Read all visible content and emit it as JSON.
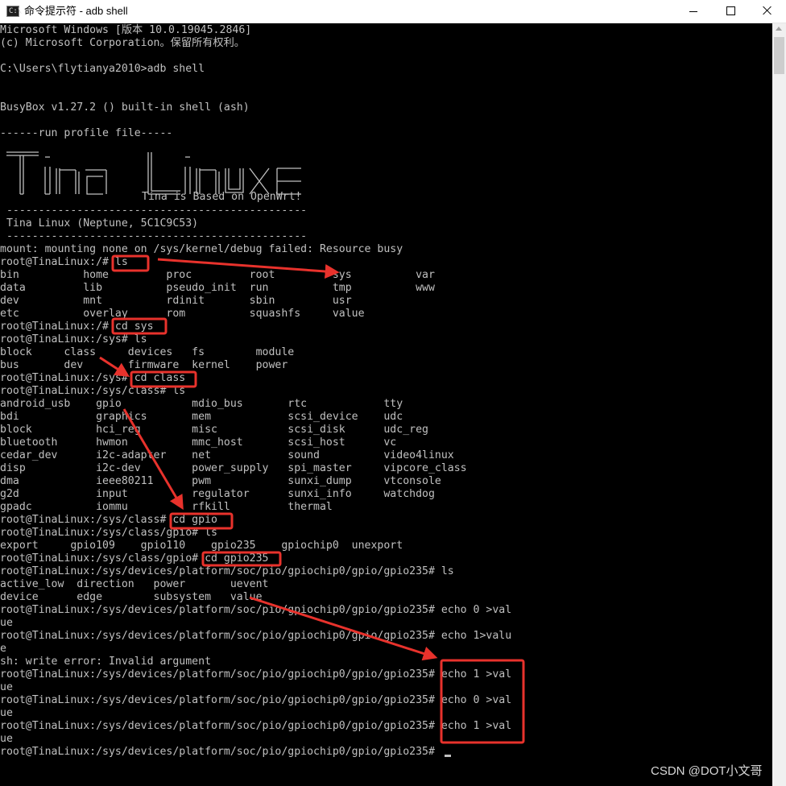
{
  "window": {
    "title": "命令提示符 - adb  shell",
    "icon": "cmd-icon",
    "controls": {
      "minimize": "minimize-icon",
      "maximize": "maximize-icon",
      "close": "close-icon"
    }
  },
  "banner": {
    "logo_text": "Tina Linux",
    "tagline": "Tina is Based on OpenWrt!"
  },
  "console_lines": [
    "Microsoft Windows [版本 10.0.19045.2846]",
    "(c) Microsoft Corporation。保留所有权利。",
    "",
    "C:\\Users\\flytianya2010>adb shell",
    "",
    "",
    "BusyBox v1.27.2 () built-in shell (ash)",
    "",
    "------run profile file-----",
    "",
    "",
    "",
    "",
    "",
    " -----------------------------------------------",
    " Tina Linux (Neptune, 5C1C9C53)",
    " -----------------------------------------------",
    "mount: mounting none on /sys/kernel/debug failed: Resource busy",
    "root@TinaLinux:/# ls",
    "bin          home         proc         root         sys          var",
    "data         lib          pseudo_init  run          tmp          www",
    "dev          mnt          rdinit       sbin         usr",
    "etc          overlay      rom          squashfs     value",
    "root@TinaLinux:/# cd sys",
    "root@TinaLinux:/sys# ls",
    "block     class     devices   fs        module",
    "bus       dev       firmware  kernel    power",
    "root@TinaLinux:/sys# cd class",
    "root@TinaLinux:/sys/class# ls",
    "android_usb    gpio           mdio_bus       rtc            tty",
    "bdi            graphics       mem            scsi_device    udc",
    "block          hci_reg        misc           scsi_disk      udc_reg",
    "bluetooth      hwmon          mmc_host       scsi_host      vc",
    "cedar_dev      i2c-adapter    net            sound          video4linux",
    "disp           i2c-dev        power_supply   spi_master     vipcore_class",
    "dma            ieee80211      pwm            sunxi_dump     vtconsole",
    "g2d            input          regulator      sunxi_info     watchdog",
    "gpadc          iommu          rfkill         thermal",
    "root@TinaLinux:/sys/class# cd gpio",
    "root@TinaLinux:/sys/class/gpio# ls",
    "export     gpio109    gpio110    gpio235    gpiochip0  unexport",
    "root@TinaLinux:/sys/class/gpio# cd gpio235",
    "root@TinaLinux:/sys/devices/platform/soc/pio/gpiochip0/gpio/gpio235# ls",
    "active_low  direction   power       uevent",
    "device      edge        subsystem   value",
    "root@TinaLinux:/sys/devices/platform/soc/pio/gpiochip0/gpio/gpio235# echo 0 >val",
    "ue",
    "root@TinaLinux:/sys/devices/platform/soc/pio/gpiochip0/gpio/gpio235# echo 1>valu",
    "e",
    "sh: write error: Invalid argument",
    "root@TinaLinux:/sys/devices/platform/soc/pio/gpiochip0/gpio/gpio235# echo 1 >val",
    "ue",
    "root@TinaLinux:/sys/devices/platform/soc/pio/gpiochip0/gpio/gpio235# echo 0 >val",
    "ue",
    "root@TinaLinux:/sys/devices/platform/soc/pio/gpiochip0/gpio/gpio235# echo 1 >val",
    "ue",
    "root@TinaLinux:/sys/devices/platform/soc/pio/gpiochip0/gpio/gpio235# "
  ],
  "annotation_color": "#e8322c",
  "watermark": "CSDN @DOT小文哥"
}
